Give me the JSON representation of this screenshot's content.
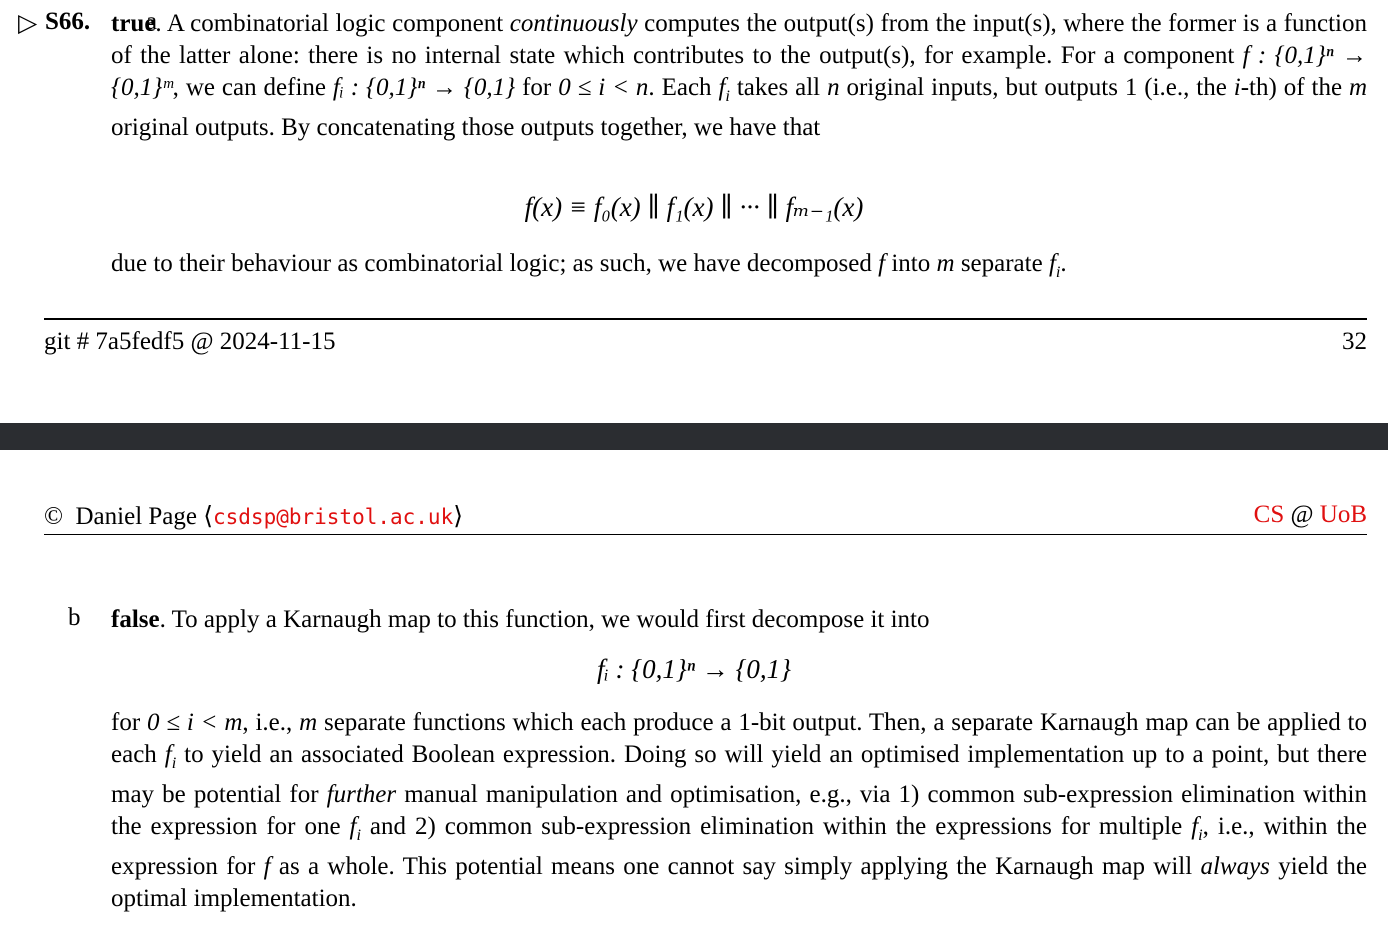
{
  "page1": {
    "solution_marker": "▷",
    "solution_id": "S66.",
    "part_a": {
      "label": "a",
      "answer": "true",
      "text_1": ". A combinatorial logic component ",
      "emph_1": "continuously",
      "text_2": " computes the output(s) from the input(s), where the former is a function of the latter alone: there is no internal state which contributes to the output(s), for example. For a component ",
      "math_f_signature": "f : {0,1}ⁿ → {0,1}ᵐ",
      "text_3": ", we can define ",
      "math_fi_signature": "fᵢ : {0,1}ⁿ → {0,1}",
      "text_4": " for ",
      "math_range": "0 ≤ i < n",
      "text_5": ". Each ",
      "text_6": " takes all ",
      "text_7": " original inputs, but outputs 1 (i.e., the ",
      "text_8": "-th) of the ",
      "text_9": " original outputs. By concatenating those outputs together, we have that",
      "equation": "f(x) ≡ f₀(x) ∥ f₁(x) ∥ ··· ∥ fₘ₋₁(x)",
      "text_10": "due to their behaviour as combinatorial logic; as such, we have decomposed ",
      "text_11": " into ",
      "text_12": " separate "
    },
    "footer": {
      "left": "git # 7a5fedf5 @ 2024-11-15",
      "page_number": "32"
    }
  },
  "page2": {
    "header": {
      "copyright": "©",
      "author": "Daniel Page",
      "email": "csdsp@bristol.ac.uk",
      "right_cs": "CS",
      "right_at": "@",
      "right_uob": "UoB"
    },
    "part_b": {
      "label": "b",
      "answer": "false",
      "text_1": ". To apply a Karnaugh map to this function, we would first decompose it into",
      "equation": "fᵢ : {0,1}ⁿ → {0,1}",
      "text_2": "for ",
      "math_range": "0 ≤ i < m",
      "text_3": ", i.e., ",
      "text_4": " separate functions which each produce a 1-bit output. Then, a separate Karnaugh map can be applied to each ",
      "text_5": " to yield an associated Boolean expression. Doing so will yield an optimised implementation up to a point, but there may be potential for ",
      "emph_1": "further",
      "text_6": " manual manipulation and optimisation, e.g., via 1) common sub-expression elimination within the expression for one ",
      "text_7": " and 2) common sub-expression elimination within the expressions for multiple ",
      "text_8": ", i.e., within the expression for ",
      "text_9": " as a whole. This potential means one cannot say simply applying the Karnaugh map will ",
      "emph_2": "always",
      "text_10": " yield the optimal implementation."
    }
  },
  "colors": {
    "separator_bar": "#2b2d31",
    "link_red": "#e01010"
  }
}
